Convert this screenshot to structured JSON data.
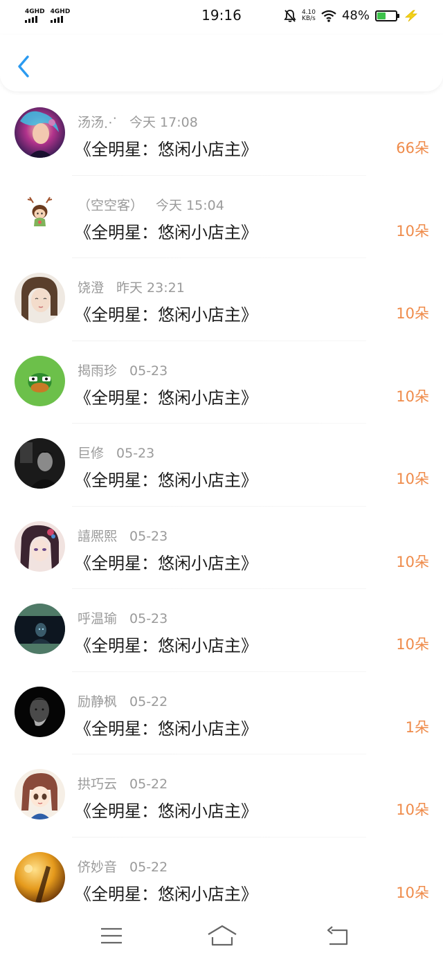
{
  "status_bar": {
    "signal_1": "4GHD",
    "signal_2": "4GHD",
    "time": "19:16",
    "speed_value": "4.10",
    "speed_unit": "KB/s",
    "battery_percent": "48%",
    "battery_level": 0.48,
    "icons": [
      "mute-icon",
      "wifi-icon",
      "battery-icon",
      "charging-icon"
    ]
  },
  "header": {
    "back_icon": "chevron-left-icon"
  },
  "colors": {
    "accent": "#2a9af0",
    "amount": "#ef8b4a",
    "meta_text": "#9a9a9a"
  },
  "list": [
    {
      "name": "汤汤⋰",
      "time": "今天 17:08",
      "title": "《全明星：悠闲小店主》",
      "amount": "66朵"
    },
    {
      "name": "（空空客）",
      "time": "今天 15:04",
      "title": "《全明星：悠闲小店主》",
      "amount": "10朵"
    },
    {
      "name": "饶澄",
      "time": "昨天 23:21",
      "title": "《全明星：悠闲小店主》",
      "amount": "10朵"
    },
    {
      "name": "揭雨珍",
      "time": "05-23",
      "title": "《全明星：悠闲小店主》",
      "amount": "10朵"
    },
    {
      "name": "巨修",
      "time": "05-23",
      "title": "《全明星：悠闲小店主》",
      "amount": "10朵"
    },
    {
      "name": "譆熈熙",
      "time": "05-23",
      "title": "《全明星：悠闲小店主》",
      "amount": "10朵"
    },
    {
      "name": "呼温瑜",
      "time": "05-23",
      "title": "《全明星：悠闲小店主》",
      "amount": "10朵"
    },
    {
      "name": "励静枫",
      "time": "05-22",
      "title": "《全明星：悠闲小店主》",
      "amount": "1朵"
    },
    {
      "name": "拱巧云",
      "time": "05-22",
      "title": "《全明星：悠闲小店主》",
      "amount": "10朵"
    },
    {
      "name": "侪妙音",
      "time": "05-22",
      "title": "《全明星：悠闲小店主》",
      "amount": "10朵"
    }
  ],
  "nav_bar": {
    "icons": [
      "menu-icon",
      "home-icon",
      "back-icon"
    ]
  }
}
